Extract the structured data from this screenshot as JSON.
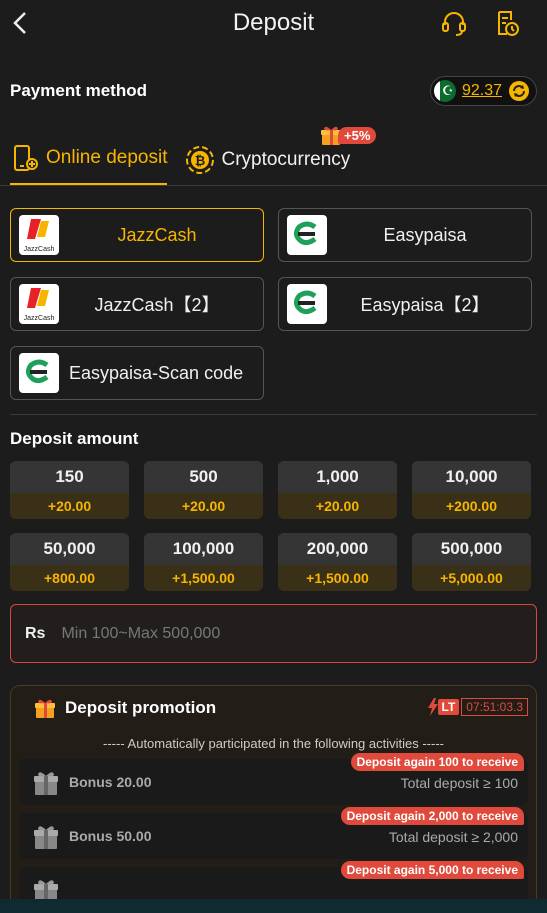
{
  "header": {
    "title": "Deposit"
  },
  "payment": {
    "label": "Payment method",
    "balance": "92.37"
  },
  "tabs": [
    {
      "label": "Online deposit"
    },
    {
      "label": "Cryptocurrency"
    }
  ],
  "promo_badge": "+5%",
  "methods": [
    {
      "name": "JazzCash"
    },
    {
      "name": "Easypaisa"
    },
    {
      "name": "JazzCash【2】"
    },
    {
      "name": "Easypaisa【2】"
    },
    {
      "name": "Easypaisa-Scan code"
    }
  ],
  "logo_text": {
    "jazz": "JazzCash"
  },
  "deposit": {
    "label": "Deposit amount",
    "amounts": [
      {
        "value": "150",
        "bonus": "+20.00"
      },
      {
        "value": "500",
        "bonus": "+20.00"
      },
      {
        "value": "1,000",
        "bonus": "+20.00"
      },
      {
        "value": "10,000",
        "bonus": "+200.00"
      },
      {
        "value": "50,000",
        "bonus": "+800.00"
      },
      {
        "value": "100,000",
        "bonus": "+1,500.00"
      },
      {
        "value": "200,000",
        "bonus": "+1,500.00"
      },
      {
        "value": "500,000",
        "bonus": "+5,000.00"
      }
    ],
    "currency": "Rs",
    "placeholder": "Min 100~Max 500,000"
  },
  "promotion": {
    "title": "Deposit promotion",
    "lt": "LT",
    "timer": "07:51:03.3",
    "note": "----- Automatically participated in the following activities -----",
    "items": [
      {
        "name": "Bonus 20.00",
        "tag": "Deposit again 100 to receive",
        "condition": "Total deposit ≥ 100"
      },
      {
        "name": "Bonus 50.00",
        "tag": "Deposit again 2,000 to receive",
        "condition": "Total deposit ≥ 2,000"
      },
      {
        "name": "",
        "tag": "Deposit again 5,000 to receive",
        "condition": ""
      }
    ]
  },
  "colors": {
    "accent": "#f7b500",
    "alert": "#e04a3c",
    "background": "#1c1c1c"
  }
}
